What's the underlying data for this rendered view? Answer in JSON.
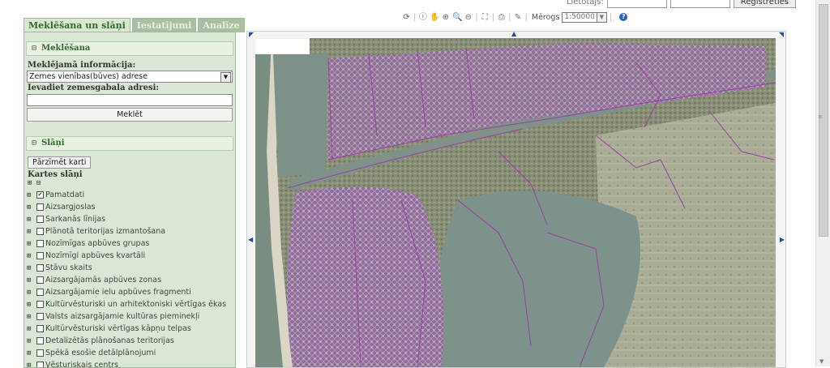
{
  "login": {
    "label": "Lietotājs:",
    "register": "Reģistrēties"
  },
  "tabs": [
    {
      "label": "Meklēšana un slāņi"
    },
    {
      "label": "Iestatījumi"
    },
    {
      "label": "Analīze"
    }
  ],
  "search_section": {
    "title": "Meklēšana",
    "info_label": "Meklējamā informācija:",
    "info_value": "Zemes vienības(būves) adrese",
    "address_label": "Ievadiet zemesgabala adresi:",
    "search_button": "Meklēt"
  },
  "layers_section": {
    "title": "Slāņi",
    "redraw_button": "Pārzīmēt karti",
    "map_layers_label": "Kartes slāņi",
    "expand_collapse": "⊞ ⊟",
    "layers": [
      {
        "label": "Pamatdati",
        "checked": true
      },
      {
        "label": "Aizsargjoslas",
        "checked": false
      },
      {
        "label": "Sarkanās līnijas",
        "checked": false
      },
      {
        "label": "Plānotā teritorijas izmantošana",
        "checked": false
      },
      {
        "label": "Nozīmīgas apbūves grupas",
        "checked": false
      },
      {
        "label": "Nozīmīgi apbūves kvartāli",
        "checked": false
      },
      {
        "label": "Stāvu skaits",
        "checked": false
      },
      {
        "label": "Aizsargājamās apbūves zonas",
        "checked": false
      },
      {
        "label": "Aizsargājamie ielu apbūves fragmenti",
        "checked": false
      },
      {
        "label": "Kultūrvēsturiski un arhitektoniski vērtīgas ēkas",
        "checked": false
      },
      {
        "label": "Valsts aizsargājamie kultūras pieminekļi",
        "checked": false
      },
      {
        "label": "Kultūrvēsturiski vērtīgas kāpņu telpas",
        "checked": false
      },
      {
        "label": "Detalizētās plānošanas teritorijas",
        "checked": false
      },
      {
        "label": "Spēkā esošie detālplānojumi",
        "checked": false
      },
      {
        "label": "Vēsturiskais centrs",
        "checked": false
      }
    ]
  },
  "toolbar": {
    "scale_label": "Mērogs",
    "scale_value": "1:50000"
  },
  "colors": {
    "panel_bg": "#dbe7d5",
    "tab_active_text": "#2f6b26",
    "map_boundary": "#9b3fa3",
    "pan_arrow": "#1f4f9a"
  }
}
